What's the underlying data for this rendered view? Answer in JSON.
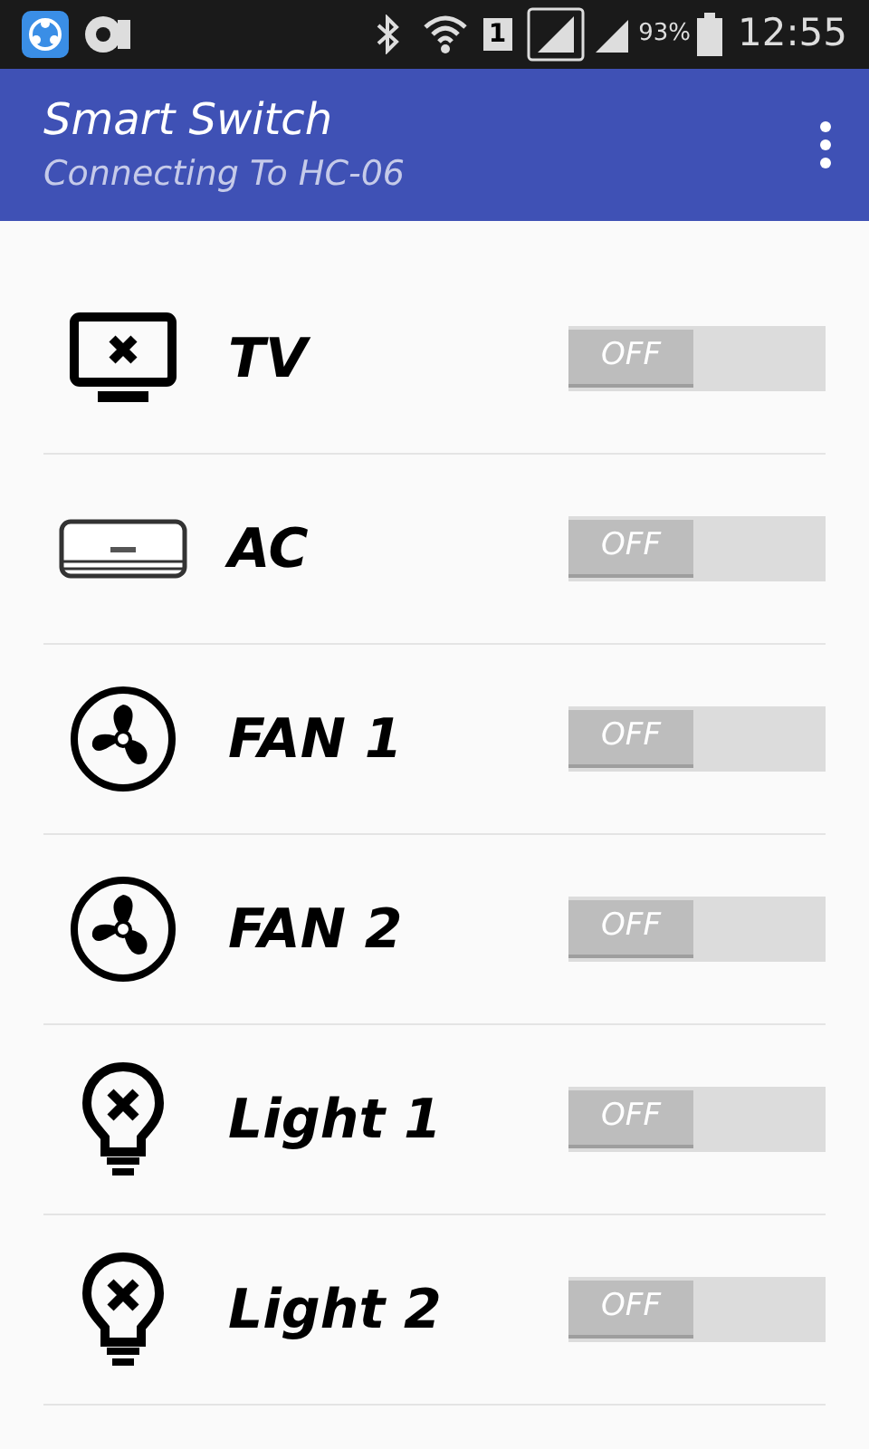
{
  "status_bar": {
    "sim": "1",
    "battery": "93%",
    "time": "12:55"
  },
  "app_bar": {
    "title": "Smart Switch",
    "subtitle": "Connecting To HC-06"
  },
  "devices": [
    {
      "kind": "tv",
      "name": "TV",
      "on": false,
      "switch_label": "OFF"
    },
    {
      "kind": "ac",
      "name": "AC",
      "on": false,
      "switch_label": "OFF"
    },
    {
      "kind": "fan",
      "name": "FAN 1",
      "on": false,
      "switch_label": "OFF"
    },
    {
      "kind": "fan",
      "name": "FAN 2",
      "on": false,
      "switch_label": "OFF"
    },
    {
      "kind": "light",
      "name": "Light 1",
      "on": false,
      "switch_label": "OFF"
    },
    {
      "kind": "light",
      "name": "Light 2",
      "on": false,
      "switch_label": "OFF"
    }
  ]
}
